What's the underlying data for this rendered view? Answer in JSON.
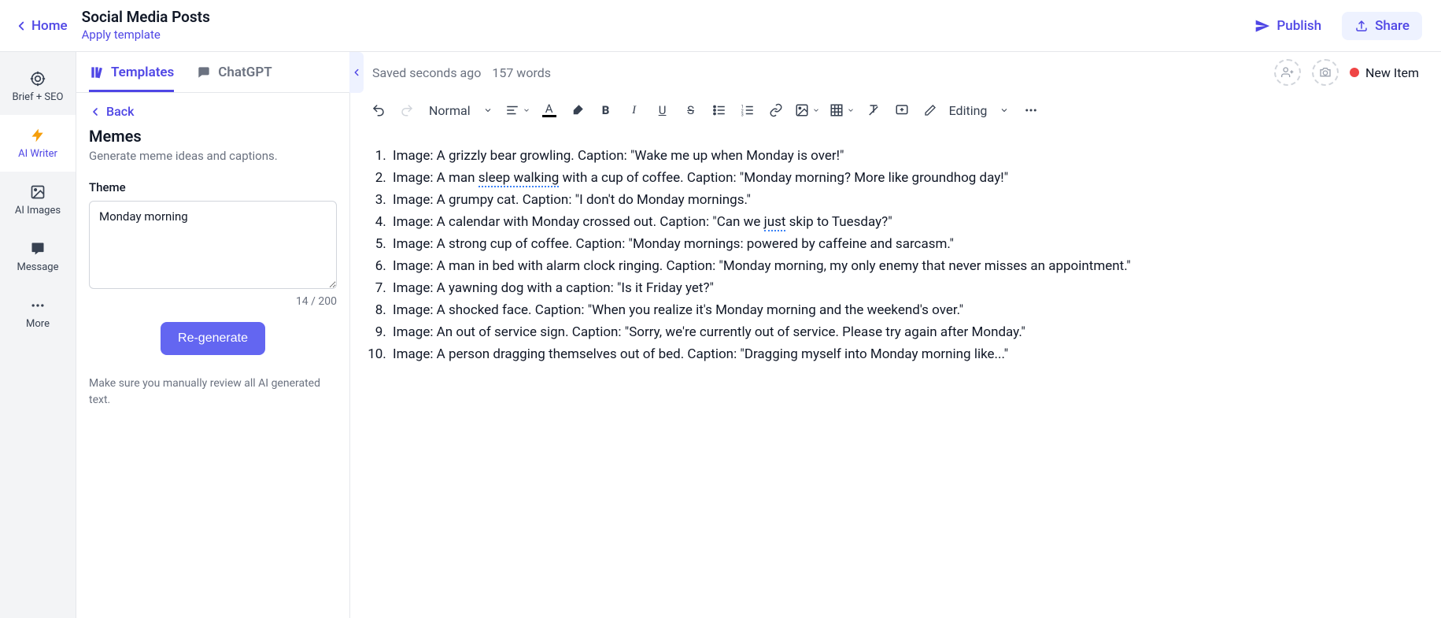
{
  "header": {
    "home": "Home",
    "title": "Social Media Posts",
    "apply_template": "Apply template",
    "publish": "Publish",
    "share": "Share"
  },
  "rail": {
    "items": [
      {
        "label": "Brief + SEO"
      },
      {
        "label": "AI Writer"
      },
      {
        "label": "AI Images"
      },
      {
        "label": "Message"
      },
      {
        "label": "More"
      }
    ]
  },
  "panel": {
    "tabs": {
      "templates": "Templates",
      "chatgpt": "ChatGPT"
    },
    "back": "Back",
    "template_name": "Memes",
    "template_desc": "Generate meme ideas and captions.",
    "theme_label": "Theme",
    "theme_value": "Monday morning",
    "char_count": "14 / 200",
    "regenerate": "Re-generate",
    "review_note": "Make sure you manually review all AI generated text."
  },
  "editor": {
    "saved": "Saved seconds ago",
    "word_count": "157 words",
    "status_label": "New Item",
    "paragraph_style": "Normal",
    "mode": "Editing",
    "items": [
      {
        "prefix": "Image: A grizzly bear growling. Caption: \"Wake me up when Monday is over!\""
      },
      {
        "segments": [
          "Image: A man ",
          {
            "text": "sleep walking",
            "spell": true
          },
          " with a cup of coffee. Caption: \"Monday morning? More like groundhog day!\""
        ]
      },
      {
        "prefix": "Image: A grumpy cat. Caption: \"I don't do Monday mornings.\""
      },
      {
        "segments": [
          "Image: A calendar with Monday crossed out. Caption: \"Can we ",
          {
            "text": "just",
            "spell": true
          },
          " skip to Tuesday?\""
        ]
      },
      {
        "prefix": "Image: A strong cup of coffee. Caption: \"Monday mornings: powered by caffeine and sarcasm.\""
      },
      {
        "prefix": "Image: A man in bed with alarm clock ringing. Caption: \"Monday morning, my only enemy that never misses an appointment.\""
      },
      {
        "prefix": "Image: A yawning dog with a caption: \"Is it Friday yet?\""
      },
      {
        "prefix": "Image: A shocked face. Caption: \"When you realize it's Monday morning and the weekend's over.\""
      },
      {
        "prefix": "Image: An out of service sign. Caption: \"Sorry, we're currently out of service. Please try again after Monday.\""
      },
      {
        "prefix": "Image: A person dragging themselves out of bed. Caption: \"Dragging myself into Monday morning like...\""
      }
    ]
  }
}
